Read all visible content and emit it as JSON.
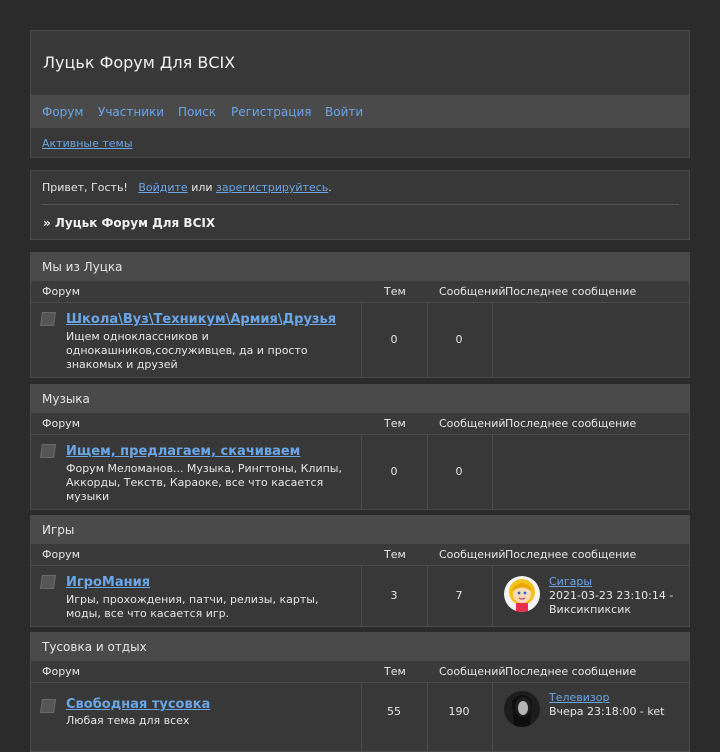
{
  "site": {
    "title": "Луцьк Форум Для ВСІХ"
  },
  "nav": {
    "items": [
      "Форум",
      "Участники",
      "Поиск",
      "Регистрация",
      "Войти"
    ],
    "active_topics": "Активные темы"
  },
  "welcome": {
    "greeting": "Привет, Гость!",
    "login": "Войдите",
    "or": "или",
    "register": "зарегистрируйтесь",
    "dot": ".",
    "breadcrumb": "» Луцьк Форум Для ВСІХ"
  },
  "columns": {
    "forum": "Форум",
    "topics": "Тем",
    "posts": "Сообщений",
    "last": "Последнее сообщение"
  },
  "categories": [
    {
      "title": "Мы из Луцка",
      "forum": {
        "name": "Школа\\Вуз\\Техникум\\Армия\\Друзья",
        "description": "Ищем одноклассников и однокашников,сослуживцев, да и просто знакомых и друзей",
        "topics": "0",
        "posts": "0"
      }
    },
    {
      "title": "Музыка",
      "forum": {
        "name": "Ищем, предлагаем, скачиваем",
        "description": "Форум Меломанов... Музыка, Рингтоны, Клипы, Аккорды, Текств, Караоке, все что касается музыки",
        "topics": "0",
        "posts": "0"
      }
    },
    {
      "title": "Игры",
      "forum": {
        "name": "ИгроМания",
        "description": "Игры, прохождения, патчи, релизы, карты, моды, все что касается игр.",
        "topics": "3",
        "posts": "7",
        "last": {
          "topic": "Сигары",
          "info": "2021-03-23 23:10:14 - Виксикпиксик"
        }
      }
    },
    {
      "title": "Тусовка и отдых",
      "forum": {
        "name": "Свободная тусовка",
        "description": "Любая тема для всех",
        "topics": "55",
        "posts": "190",
        "last": {
          "topic": "Телевизор",
          "info": "Вчера 23:18:00 - ket"
        }
      }
    }
  ]
}
